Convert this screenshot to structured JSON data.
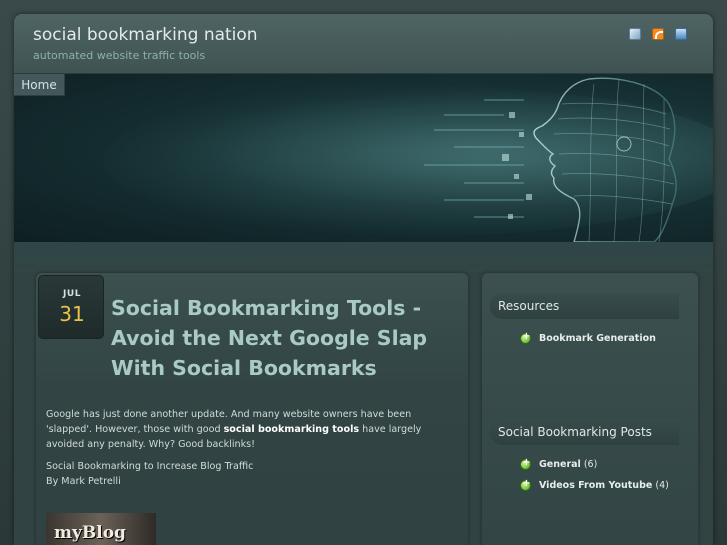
{
  "site": {
    "title": "social bookmarking nation",
    "description": "automated website traffic tools"
  },
  "header_icons": [
    "email-icon",
    "rss-icon",
    "twitter-icon"
  ],
  "nav": {
    "items": [
      {
        "label": "Home"
      }
    ]
  },
  "post": {
    "month": "JUL",
    "day": "31",
    "title": "Social Bookmarking Tools - Avoid the Next Google Slap With Social Bookmarks",
    "paragraph1_before": "Google has just done another update. And many website owners have been 'slapped'. However, those with good ",
    "paragraph1_bold": "social bookmarking tools",
    "paragraph1_after": " have largely avoided any penalty. Why? Good backlinks!",
    "paragraph2_line1": "Social Bookmarking to Increase Blog Traffic",
    "paragraph2_line2": "By Mark Petrelli",
    "image_text": "myBlog"
  },
  "sidebar": {
    "widgets": [
      {
        "title": "Resources",
        "items": [
          {
            "label": "Bookmark Generation",
            "count": ""
          }
        ]
      },
      {
        "title": "Social Bookmarking Posts",
        "items": [
          {
            "label": "General",
            "count": "(6)"
          },
          {
            "label": "Videos From Youtube",
            "count": "(4)"
          }
        ]
      }
    ]
  },
  "colors": {
    "accent_title": "#a9cac6",
    "date_day": "#e8c24a",
    "bullet": "#4fa61e"
  }
}
